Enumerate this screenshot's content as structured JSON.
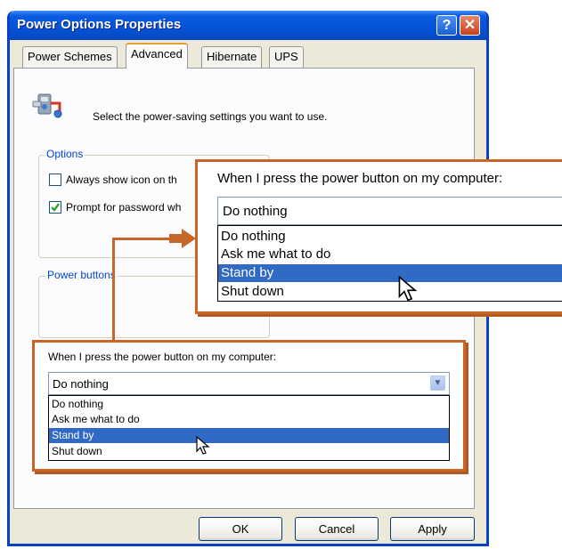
{
  "window": {
    "title": "Power Options Properties",
    "help_glyph": "?",
    "close_glyph": "✕"
  },
  "tabs": [
    {
      "label": "Power Schemes",
      "active": false
    },
    {
      "label": "Advanced",
      "active": true
    },
    {
      "label": "Hibernate",
      "active": false
    },
    {
      "label": "UPS",
      "active": false
    }
  ],
  "header": {
    "text": "Select the power-saving settings you want to use.",
    "icon": "power-settings-icon"
  },
  "options": {
    "label": "Options",
    "checkboxes": [
      {
        "label": "Always show icon on th",
        "checked": false
      },
      {
        "label": "Prompt for password wh",
        "checked": true
      }
    ]
  },
  "power_buttons": {
    "label": "Power buttons"
  },
  "dropdown_small": {
    "prompt": "When I press the power button on my computer:",
    "selected": "Do nothing",
    "items": [
      "Do nothing",
      "Ask me what to do",
      "Stand by",
      "Shut down"
    ],
    "highlighted": "Stand by"
  },
  "dropdown_large": {
    "prompt": "When I press the power button on my computer:",
    "selected": "Do nothing",
    "items": [
      "Do nothing",
      "Ask me what to do",
      "Stand by",
      "Shut down"
    ],
    "highlighted": "Stand by"
  },
  "buttons": {
    "ok": "OK",
    "cancel": "Cancel",
    "apply": "Apply"
  },
  "colors": {
    "callout": "#c8662a",
    "selection": "#316ac5",
    "titlebar": "#0553d6"
  }
}
